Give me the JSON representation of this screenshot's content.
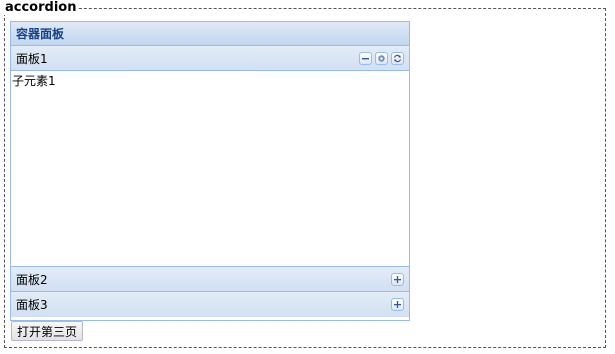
{
  "fieldset": {
    "legend": "accordion"
  },
  "accordion": {
    "title": "容器面板",
    "panels": [
      {
        "title": "面板1",
        "expanded": true,
        "content": "子元素1",
        "tools": [
          "minus-icon",
          "gear-icon",
          "refresh-icon"
        ]
      },
      {
        "title": "面板2",
        "expanded": false,
        "tools": [
          "plus-icon"
        ]
      },
      {
        "title": "面板3",
        "expanded": false,
        "tools": [
          "plus-icon"
        ]
      }
    ]
  },
  "open_third_button": "打开第三页",
  "colors": {
    "border": "#99bbe8",
    "header_text": "#15428b"
  }
}
